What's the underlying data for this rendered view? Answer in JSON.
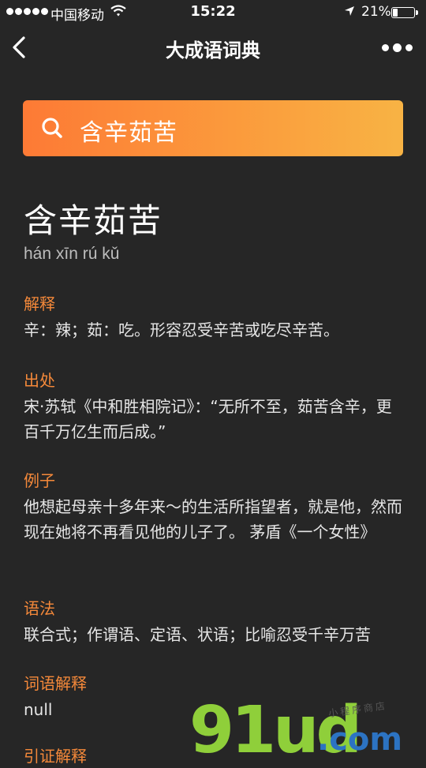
{
  "status_bar": {
    "carrier": "中国移动",
    "time": "15:22",
    "battery_percent": "21%",
    "icons": [
      "signal-dots-icon",
      "wifi-icon",
      "location-arrow-icon",
      "battery-icon"
    ]
  },
  "nav": {
    "title": "大成语词典",
    "back_icon": "chevron-left-icon",
    "more_icon": "more-dots-icon"
  },
  "search": {
    "value": "含辛茹苦",
    "icon": "search-icon",
    "gradient": [
      "#fd7a35",
      "#f8b344"
    ]
  },
  "idiom": {
    "title": "含辛茹苦",
    "pinyin": "hán xīn rú kǔ"
  },
  "sections": [
    {
      "label": "解释",
      "content": "辛：辣；茹：吃。形容忍受辛苦或吃尽辛苦。"
    },
    {
      "label": "出处",
      "content": "宋·苏轼《中和胜相院记》：“无所不至，茹苦含辛，更百千万亿生而后成。”"
    },
    {
      "label": "例子",
      "content": "他想起母亲十多年来～的生活所指望者，就是他，然而现在她将不再看见他的儿子了。 茅盾《一个女性》"
    },
    {
      "label": "语法",
      "content": "联合式；作谓语、定语、状语；比喻忍受千辛万苦"
    },
    {
      "label": "词语解释",
      "content": "null"
    },
    {
      "label": "引证解释",
      "content": ""
    }
  ],
  "watermark": {
    "main": "91ud",
    "domain": ".com",
    "tagline": "小程序商店"
  },
  "colors": {
    "background": "#262626",
    "accent_label": "#f5893a",
    "text": "#e6e6e6"
  }
}
